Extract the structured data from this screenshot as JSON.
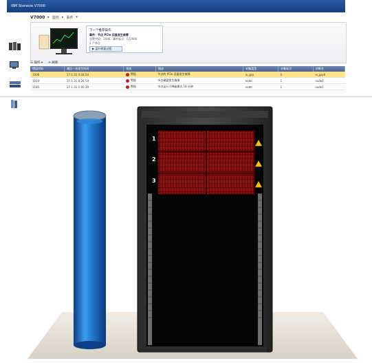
{
  "app": {
    "title": "IBM Storwize V7000"
  },
  "breadcrumb": {
    "root": "V7000",
    "items": [
      "监控",
      "事件"
    ]
  },
  "next_action": {
    "heading": "下一个推荐操作",
    "title": "事件：节点 PCIe 设备发生故障",
    "line1": "告警代码：1006，事件标识：072900",
    "line2": "2 个节点",
    "run_fix_label": "运行修复过程"
  },
  "toolbar": {
    "actions_label": "操作",
    "refresh_label": "刷新"
  },
  "events_table": {
    "columns": [
      "错误代码",
      "最后一次发生时间",
      "状态",
      "描述",
      "对象类型",
      "对象标识",
      "对象名"
    ],
    "rows": [
      {
        "code": "1006",
        "time": "17-1-31 0:26:54",
        "status": "警报",
        "description": "节点的 PCIe 设备发生故障",
        "object_type": "io_grp",
        "object_id": "0",
        "object_name": "io_grp0"
      },
      {
        "code": "1020",
        "time": "17-1-31 0:26:54",
        "status": "警报",
        "description": "节点硬盘发生故障",
        "object_type": "node",
        "object_id": "1",
        "object_name": "node1"
      },
      {
        "code": "1185",
        "time": "17-1-31 1:00:29",
        "status": "警报",
        "description": "节点运行于降级模式 18 分钟",
        "object_type": "node",
        "object_id": "1",
        "object_name": "node1"
      }
    ],
    "selected_row": 0
  },
  "rack": {
    "enclosures": [
      "1",
      "2",
      "3"
    ]
  },
  "colors": {
    "title_bar": "#1f4a93",
    "status_alert": "#c41d1d",
    "selected_row": "#ffe48a",
    "cylinder": "#1f74c8",
    "drive_bay": "#8c1010",
    "warning": "#f2c21b"
  }
}
